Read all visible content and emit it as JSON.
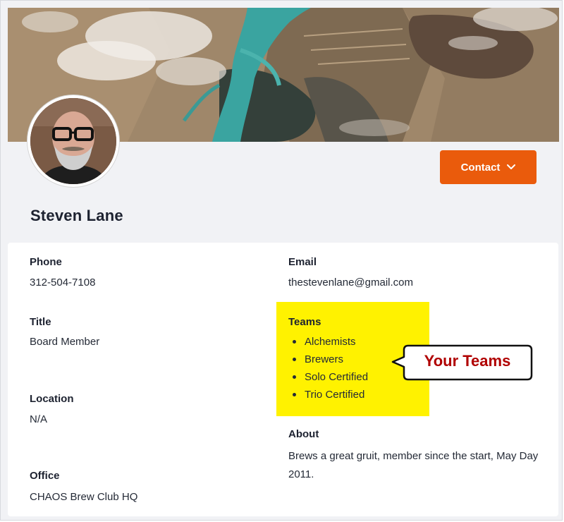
{
  "profile": {
    "name": "Steven Lane",
    "contact_button_label": "Contact"
  },
  "details": {
    "phone": {
      "label": "Phone",
      "value": "312-504-7108"
    },
    "email": {
      "label": "Email",
      "value": "thestevenlane@gmail.com"
    },
    "title": {
      "label": "Title",
      "value": "Board Member"
    },
    "teams": {
      "label": "Teams",
      "items": [
        "Alchemists",
        "Brewers",
        "Solo Certified",
        "Trio Certified"
      ]
    },
    "location": {
      "label": "Location",
      "value": "N/A"
    },
    "about": {
      "label": "About",
      "value": "Brews a great gruit, member since the start, May Day 2011."
    },
    "office": {
      "label": "Office",
      "value": "CHAOS Brew Club HQ"
    }
  },
  "annotation": {
    "callout_text": "Your Teams",
    "highlight_color": "#fff200",
    "callout_text_color": "#b00000"
  },
  "colors": {
    "accent": "#ea5b0c",
    "page_background": "#f1f2f5"
  },
  "icons": {
    "contact_chevron": "chevron-down-icon"
  }
}
